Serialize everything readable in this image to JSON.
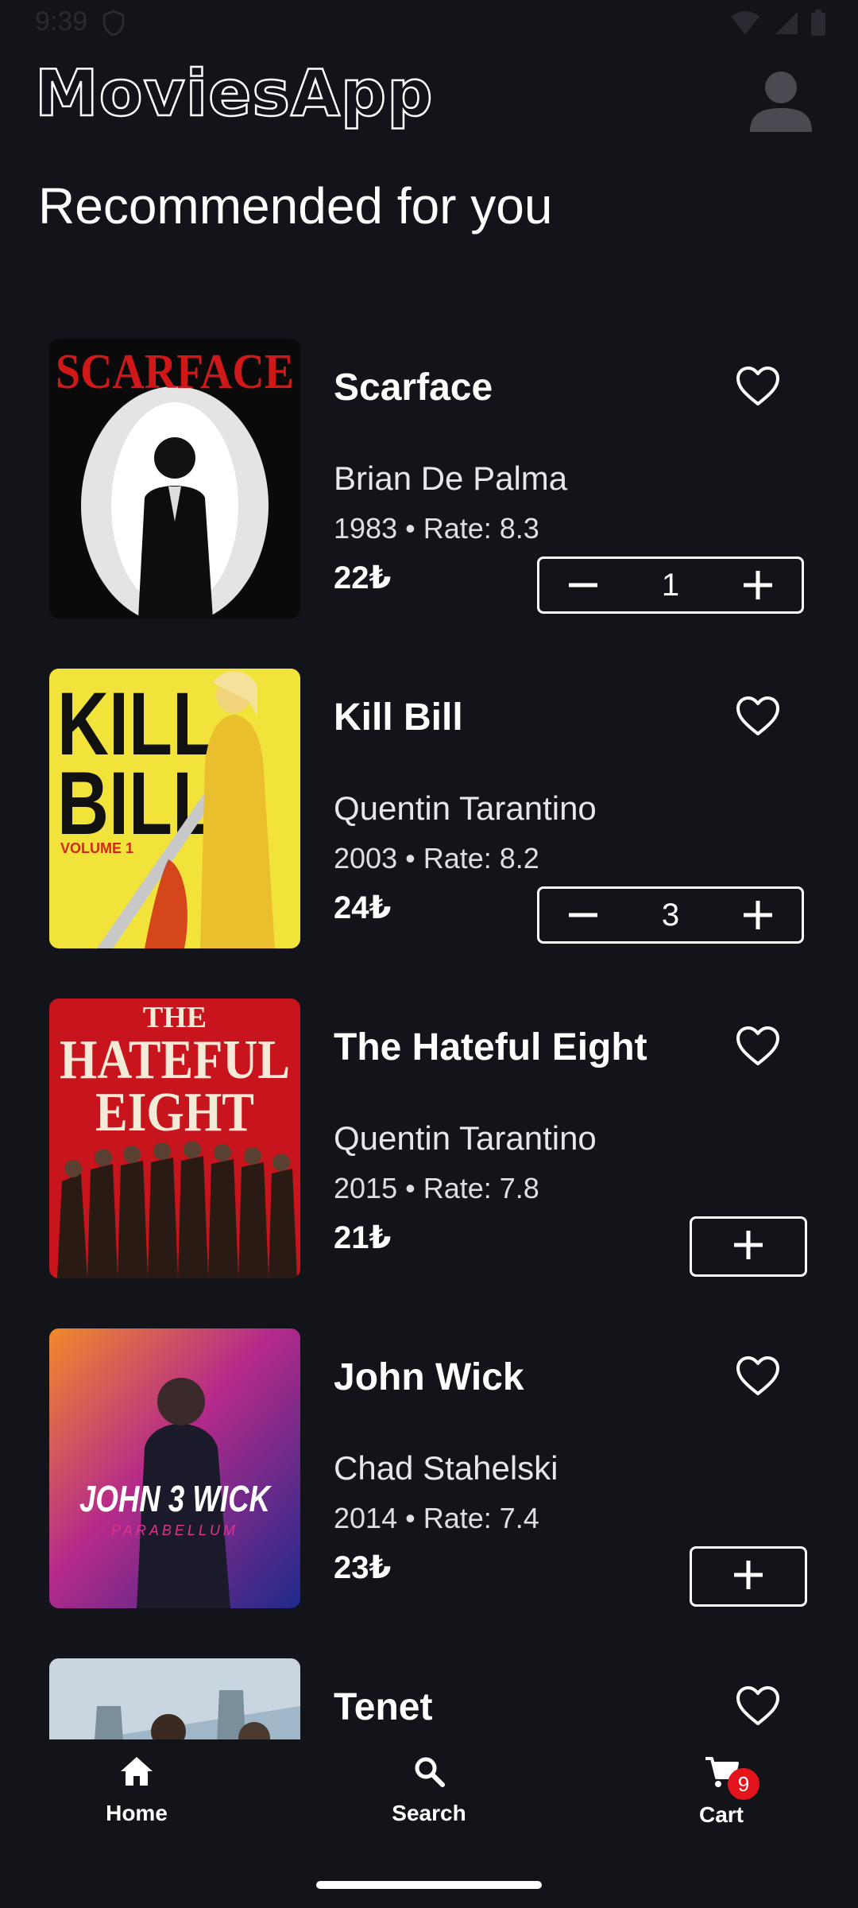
{
  "status_bar": {
    "time": "9:39"
  },
  "header": {
    "logo": "MoviesApp"
  },
  "section": {
    "title": "Recommended for you"
  },
  "movies": [
    {
      "title": "Scarface",
      "director": "Brian De Palma",
      "meta": "1983 • Rate: 8.3",
      "price": "22₺",
      "quantity": "1",
      "poster": {
        "text": "SCARFACE",
        "colors": [
          "#0a0a0a",
          "#e0e0e0",
          "#d01818"
        ]
      }
    },
    {
      "title": "Kill Bill",
      "director": "Quentin Tarantino",
      "meta": "2003 • Rate: 8.2",
      "price": "24₺",
      "quantity": "3",
      "poster": {
        "text": "KILL BILL",
        "subtext": "VOLUME 1",
        "colors": [
          "#f2e33a",
          "#111111",
          "#d02a16"
        ]
      }
    },
    {
      "title": "The Hateful Eight",
      "director": "Quentin Tarantino",
      "meta": "2015 • Rate: 7.8",
      "price": "21₺",
      "quantity": null,
      "poster": {
        "text": "THE HATEFUL EIGHT",
        "colors": [
          "#c8141d",
          "#f3ead8",
          "#2a1a14"
        ]
      }
    },
    {
      "title": "John Wick",
      "director": "Chad Stahelski",
      "meta": "2014 • Rate: 7.4",
      "price": "23₺",
      "quantity": null,
      "poster": {
        "text": "JOHN 3 WICK",
        "subtext": "PARABELLUM",
        "colors": [
          "#1e2a8a",
          "#e0338c",
          "#f08a2a"
        ]
      }
    },
    {
      "title": "Tenet",
      "director": "",
      "meta": "",
      "price": "",
      "quantity": null,
      "poster": {
        "colors": [
          "#7a9db8",
          "#c9d6df",
          "#2b3640"
        ]
      }
    }
  ],
  "bottom_nav": {
    "items": [
      {
        "label": "Home",
        "icon": "home-icon"
      },
      {
        "label": "Search",
        "icon": "search-icon"
      },
      {
        "label": "Cart",
        "icon": "cart-icon",
        "badge": "9"
      }
    ]
  },
  "colors": {
    "background": "#13131a",
    "text": "#ffffff",
    "badge": "#e3141c"
  }
}
